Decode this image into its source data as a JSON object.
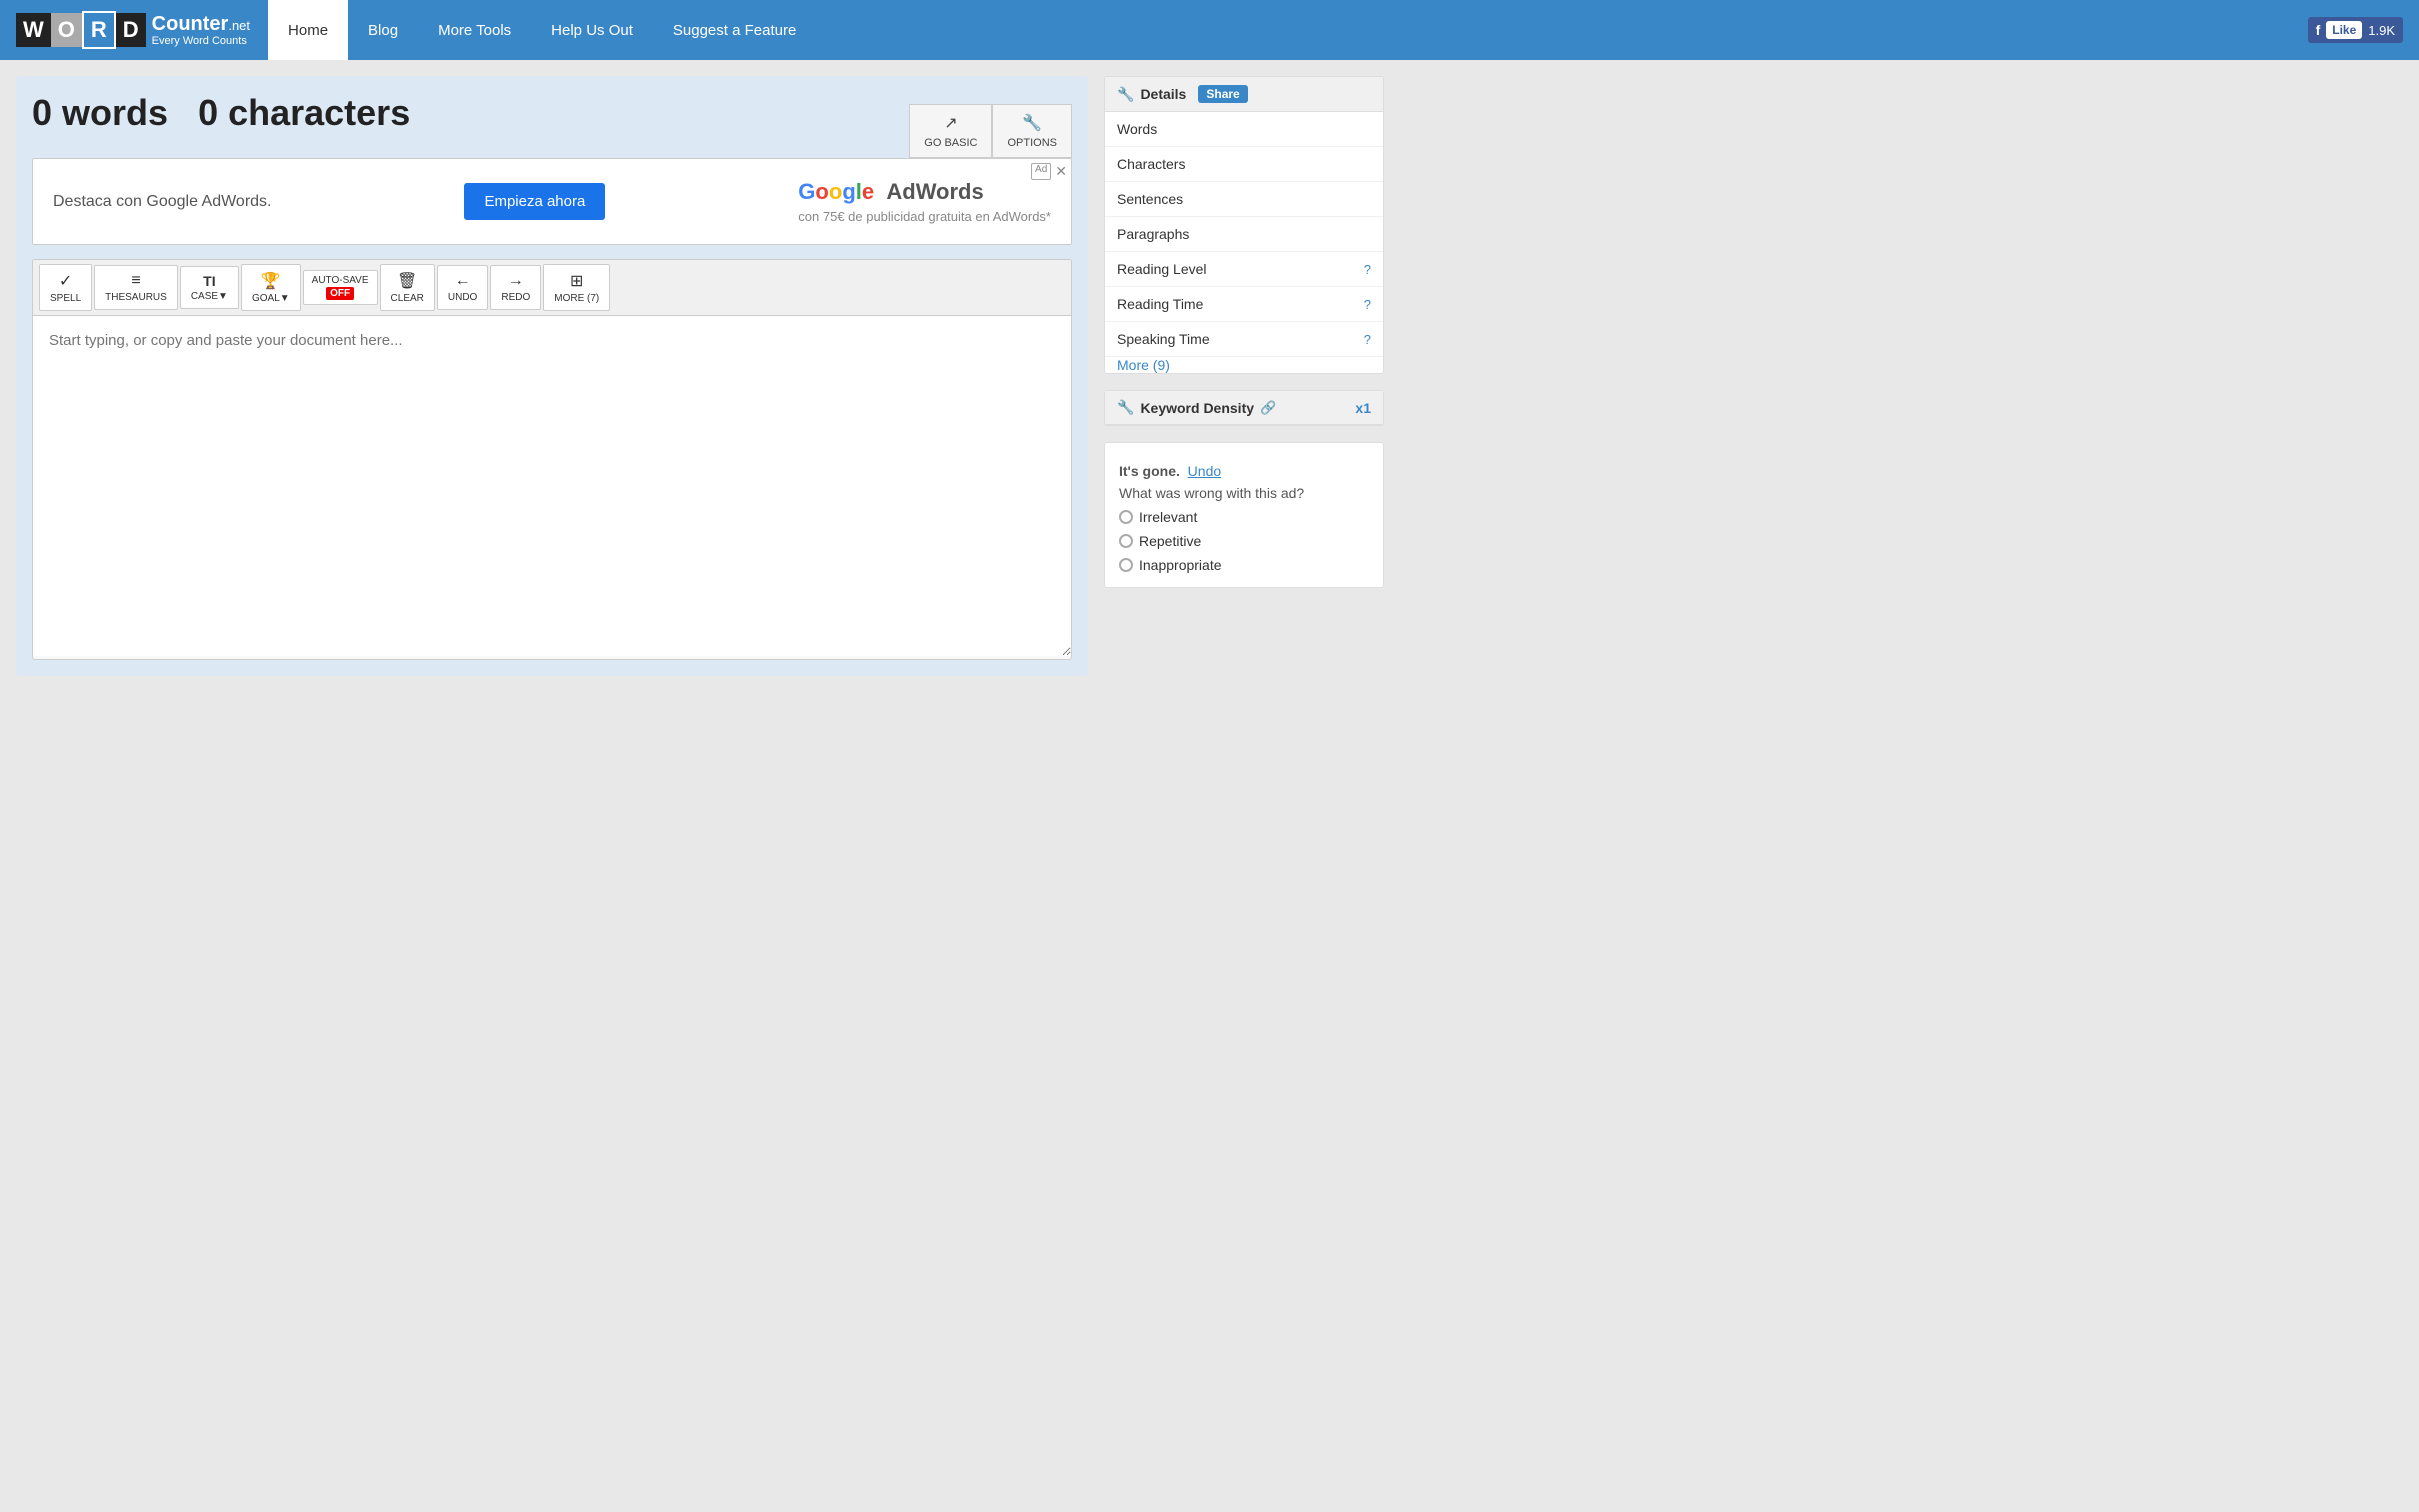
{
  "header": {
    "logo": {
      "letters": [
        "W",
        "O",
        "R",
        "D"
      ],
      "brand": "Counter",
      "net": ".net",
      "tagline": "Every Word Counts"
    },
    "nav": [
      {
        "label": "Home",
        "active": true
      },
      {
        "label": "Blog",
        "active": false
      },
      {
        "label": "More Tools",
        "active": false
      },
      {
        "label": "Help Us Out",
        "active": false
      },
      {
        "label": "Suggest a Feature",
        "active": false
      }
    ],
    "fb_like": "Like",
    "fb_count": "1.9K"
  },
  "main": {
    "word_count": "0 words",
    "char_count": "0 characters",
    "buttons": {
      "go_basic": "GO BASIC",
      "options": "OPTIONS"
    },
    "ad": {
      "text": "Destaca con Google AdWords.",
      "cta": "Empieza ahora",
      "brand": "Google AdWords",
      "subtext": "con 75€ de publicidad gratuita en AdWords*"
    },
    "toolbar": [
      {
        "icon": "✓",
        "label": "SPELL"
      },
      {
        "icon": "≡",
        "label": "THESAURUS"
      },
      {
        "icon": "TI",
        "label": "CASE▼"
      },
      {
        "icon": "🏆",
        "label": "GOAL▼"
      },
      {
        "icon": "AUTO-SAVE",
        "label": "",
        "special": "autosave"
      },
      {
        "icon": "🗑",
        "label": "CLEAR"
      },
      {
        "icon": "←",
        "label": "UNDO"
      },
      {
        "icon": "→",
        "label": "REDO"
      },
      {
        "icon": "⊞",
        "label": "MORE (7)"
      }
    ],
    "editor_placeholder": "Start typing, or copy and paste your document here..."
  },
  "sidebar": {
    "details_label": "Details",
    "share_label": "Share",
    "items": [
      {
        "label": "Words",
        "has_help": false
      },
      {
        "label": "Characters",
        "has_help": false
      },
      {
        "label": "Sentences",
        "has_help": false
      },
      {
        "label": "Paragraphs",
        "has_help": false
      },
      {
        "label": "Reading Level",
        "has_help": true
      },
      {
        "label": "Reading Time",
        "has_help": true
      },
      {
        "label": "Speaking Time",
        "has_help": true
      }
    ],
    "more_label": "More (9)",
    "keyword_label": "Keyword Density",
    "keyword_x1": "x1"
  },
  "ad_feedback": {
    "gone": "It's gone.",
    "undo": "Undo",
    "question": "What was wrong with this ad?",
    "options": [
      "Irrelevant",
      "Repetitive",
      "Inappropriate"
    ]
  },
  "icons": {
    "wrench": "🔧",
    "share": "🔗",
    "external": "↗",
    "options": "🔧",
    "facebook_f": "f",
    "question": "?"
  }
}
